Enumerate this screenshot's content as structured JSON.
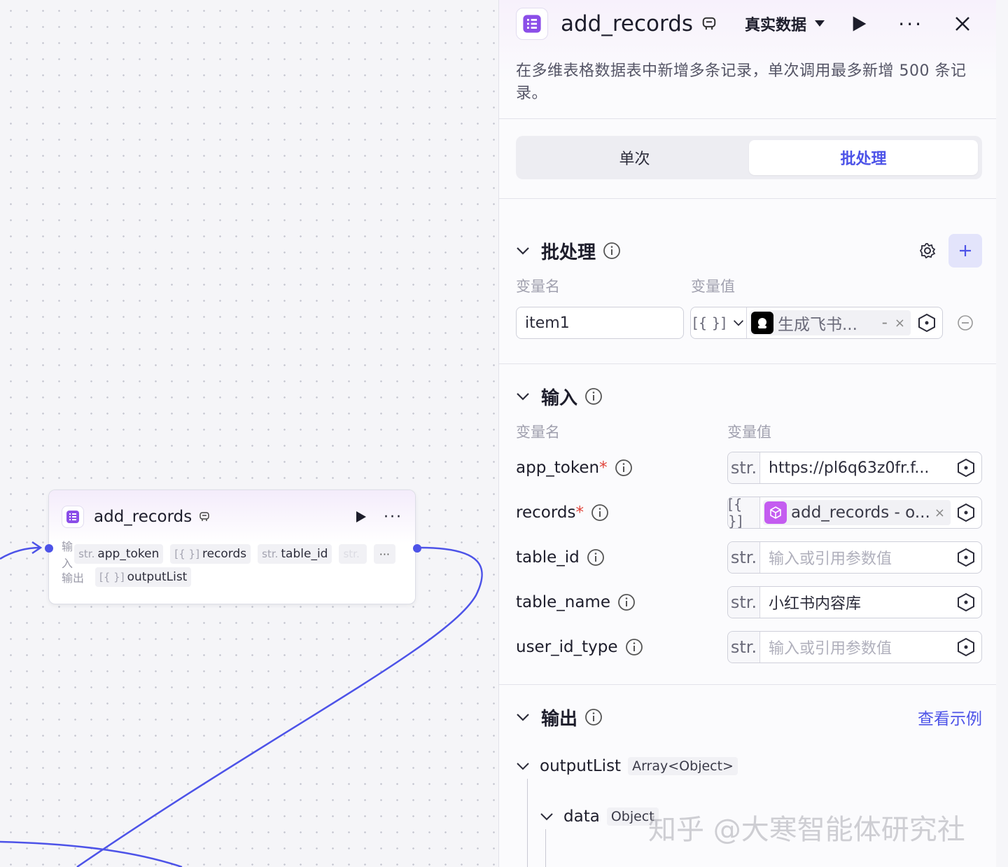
{
  "node": {
    "title": "add_records",
    "input_label": "输入",
    "output_label": "输出",
    "inputs": [
      {
        "type": "str.",
        "name": "app_token"
      },
      {
        "type": "[{ }]",
        "name": "records"
      },
      {
        "type": "str.",
        "name": "table_id"
      },
      {
        "type": "str.",
        "name": ""
      }
    ],
    "more_label": "···",
    "outputs": [
      {
        "type": "[{ }]",
        "name": "outputList"
      }
    ]
  },
  "panel": {
    "title": "add_records",
    "data_mode": "真实数据",
    "description": "在多维表格数据表中新增多条记录，单次调用最多新增 500 条记录。",
    "tabs": [
      {
        "label": "单次",
        "active": false
      },
      {
        "label": "批处理",
        "active": true
      }
    ],
    "batch": {
      "title": "批处理",
      "col_name": "变量名",
      "col_value": "变量值",
      "item_name": "item1",
      "type_label": "[{ }]",
      "ref_text": "生成飞书...",
      "ref_suffix": "-"
    },
    "input": {
      "title": "输入",
      "col_name": "变量名",
      "col_value": "变量值",
      "rows": [
        {
          "name": "app_token",
          "required": true,
          "type": "str.",
          "value": "https://pl6q63z0fr.f...",
          "placeholder": false
        },
        {
          "name": "records",
          "required": true,
          "type": "[{ }]",
          "value": "add_records - o...",
          "ref": true
        },
        {
          "name": "table_id",
          "required": false,
          "type": "str.",
          "value": "输入或引用参数值",
          "placeholder": true
        },
        {
          "name": "table_name",
          "required": false,
          "type": "str.",
          "value": "小红书内容库",
          "placeholder": false
        },
        {
          "name": "user_id_type",
          "required": false,
          "type": "str.",
          "value": "输入或引用参数值",
          "placeholder": true
        }
      ]
    },
    "output": {
      "title": "输出",
      "example_link": "查看示例",
      "tree": [
        {
          "name": "outputList",
          "type": "Array<Object>"
        },
        {
          "name": "data",
          "type": "Object"
        }
      ]
    }
  },
  "watermark": "知乎 @大寒智能体研究社",
  "colors": {
    "accent": "#4d53e8",
    "required": "#e0443a",
    "node_icon": "#8b4ee8"
  }
}
